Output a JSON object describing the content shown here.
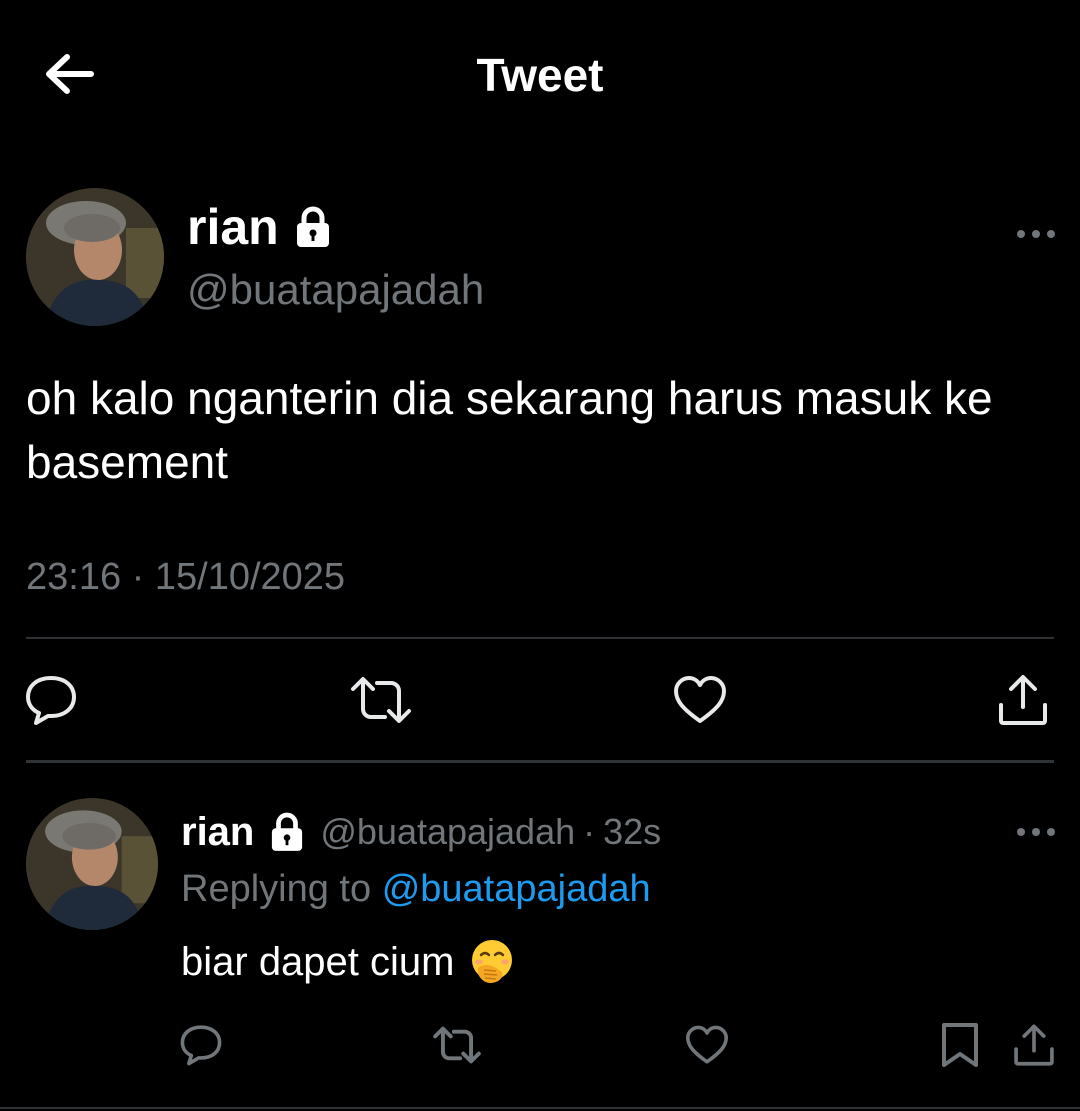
{
  "header": {
    "title": "Tweet",
    "back_icon": "arrow-left-icon"
  },
  "tweet": {
    "author_name": "rian",
    "author_handle": "@buatapajadah",
    "locked_icon": "lock-icon",
    "text": "oh kalo nganterin dia sekarang harus masuk ke basement",
    "timestamp": "23:16 · 15/10/2025",
    "actions": [
      "reply-icon",
      "retweet-icon",
      "like-icon",
      "share-icon"
    ]
  },
  "reply": {
    "author_name": "rian",
    "author_handle": "@buatapajadah",
    "separator": "·",
    "time": "32s",
    "replying_label": "Replying to",
    "replying_handle": "@buatapajadah",
    "text": "biar dapet cium",
    "emoji": "face-with-hand-over-mouth",
    "actions": [
      "reply-icon",
      "retweet-icon",
      "like-icon",
      "bookmark-icon",
      "share-icon"
    ]
  },
  "colors": {
    "background": "#000000",
    "text": "#ffffff",
    "muted": "#71767b",
    "link": "#1d9bf0",
    "divider": "#2f3336"
  }
}
